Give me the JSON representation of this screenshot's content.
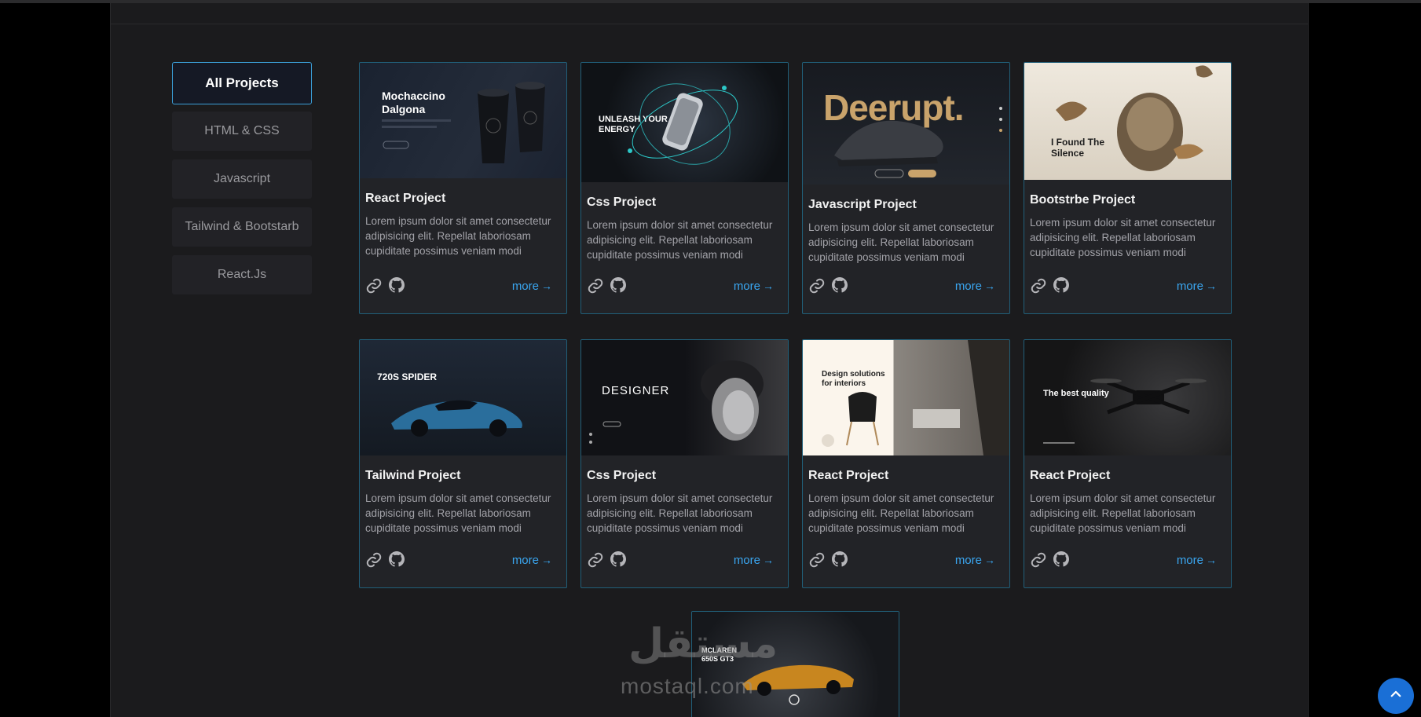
{
  "filters": [
    "All Projects",
    "HTML & CSS",
    "Javascript",
    "Tailwind & Bootstarb",
    "React.Js"
  ],
  "cards": [
    {
      "title": "React Project",
      "desc": "Lorem ipsum dolor sit amet consectetur adipisicing elit. Repellat laboriosam cupiditate possimus veniam modi",
      "more": "more",
      "thumb_text": "Mochaccino Dalgona"
    },
    {
      "title": "Css Project",
      "desc": "Lorem ipsum dolor sit amet consectetur adipisicing elit. Repellat laboriosam cupiditate possimus veniam modi",
      "more": "more",
      "thumb_text": "UNLEASH YOUR ENERGY"
    },
    {
      "title": "Javascript Project",
      "desc": "Lorem ipsum dolor sit amet consectetur adipisicing elit. Repellat laboriosam cupiditate possimus veniam modi",
      "more": "more",
      "thumb_text": "Deerupt."
    },
    {
      "title": "Bootstrbe Project",
      "desc": "Lorem ipsum dolor sit amet consectetur adipisicing elit. Repellat laboriosam cupiditate possimus veniam modi",
      "more": "more",
      "thumb_text": "I Found The Silence"
    },
    {
      "title": "Tailwind Project",
      "desc": "Lorem ipsum dolor sit amet consectetur adipisicing elit. Repellat laboriosam cupiditate possimus veniam modi",
      "more": "more",
      "thumb_text": "720S SPIDER"
    },
    {
      "title": "Css Project",
      "desc": "Lorem ipsum dolor sit amet consectetur adipisicing elit. Repellat laboriosam cupiditate possimus veniam modi",
      "more": "more",
      "thumb_text": "DESIGNER"
    },
    {
      "title": "React Project",
      "desc": "Lorem ipsum dolor sit amet consectetur adipisicing elit. Repellat laboriosam cupiditate possimus veniam modi",
      "more": "more",
      "thumb_text": "Design solutions for interiors"
    },
    {
      "title": "React Project",
      "desc": "Lorem ipsum dolor sit amet consectetur adipisicing elit. Repellat laboriosam cupiditate possimus veniam modi",
      "more": "more",
      "thumb_text": "The best quality"
    }
  ],
  "partial_card": {
    "thumb_text": "MCLAREN 650S GT3"
  },
  "watermark": {
    "arabic": "مستقل",
    "latin": "mostaql.com"
  },
  "icons": {
    "link": "link-icon",
    "github": "github-icon",
    "arrow": "arrow-right-icon",
    "scroll_top": "chevron-up-icon"
  },
  "colors": {
    "accent": "#3aa6f0",
    "card_border": "#215f79",
    "panel": "#1b1b1d",
    "scroll_button": "#1a6fd6"
  }
}
